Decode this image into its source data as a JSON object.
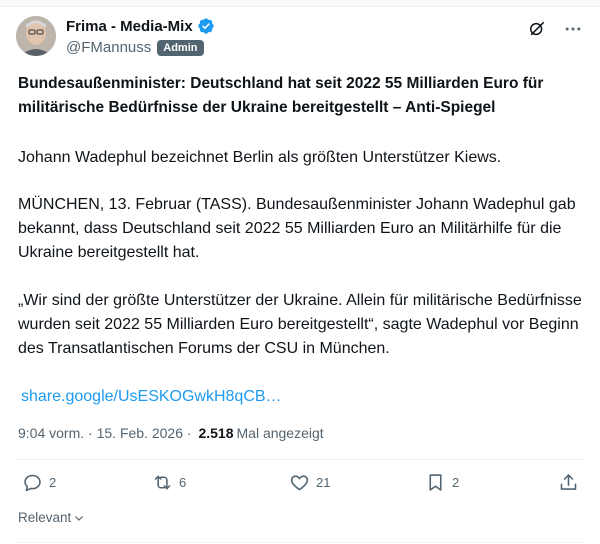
{
  "author": {
    "name": "Frima - Media-Mix",
    "handle": "@FMannuss",
    "badge": "Admin",
    "verified_color": "#1d9bf0"
  },
  "post": {
    "headline": "Bundesaußenminister: Deutschland hat seit 2022 55 Milliarden Euro für militärische Bedürfnisse der Ukraine bereitgestellt – Anti-Spiegel",
    "paragraph_1": "Johann Wadephul bezeichnet Berlin als größten Unterstützer Kiews.",
    "paragraph_2": "MÜNCHEN, 13. Februar (TASS). Bundesaußenminister Johann Wadephul gab bekannt, dass Deutschland seit 2022 55 Milliarden Euro an Militärhilfe für die Ukraine bereitgestellt hat.",
    "paragraph_3": "„Wir sind der größte Unterstützer der Ukraine. Allein für militärische Bedürfnisse wurden seit 2022 55 Milliarden Euro bereitgestellt“, sagte Wadephul vor Beginn des Transatlantischen Forums der CSU in München.",
    "link": "share.google/UsESKOGwkH8qCB…"
  },
  "meta": {
    "time": "9:04 vorm.",
    "separator": " · ",
    "date": "15. Feb. 2026",
    "separator2": " · ",
    "views_count": "2.518",
    "views_label": "Mal angezeigt"
  },
  "actions": {
    "replies": "2",
    "reposts": "6",
    "likes": "21",
    "bookmarks": "2"
  },
  "sort": {
    "label": "Relevant"
  },
  "icons": {
    "grok": "grok-icon",
    "more": "more-icon",
    "reply": "reply-icon",
    "repost": "repost-icon",
    "like": "heart-icon",
    "bookmark": "bookmark-icon",
    "share": "share-icon"
  }
}
